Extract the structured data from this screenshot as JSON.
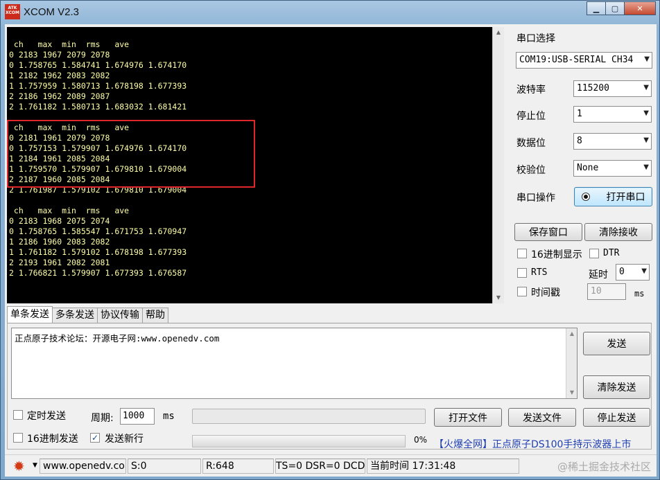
{
  "window": {
    "title": "XCOM V2.3",
    "logo_text": "ATK XCOM"
  },
  "terminal": {
    "lines": [
      " ch   max  min  rms   ave",
      "0 2183 1967 2079 2078",
      "0 1.758765 1.584741 1.674976 1.674170",
      "1 2182 1962 2083 2082",
      "1 1.757959 1.580713 1.678198 1.677393",
      "2 2186 1962 2089 2087",
      "2 1.761182 1.580713 1.683032 1.681421",
      "",
      " ch   max  min  rms   ave",
      "0 2181 1961 2079 2078",
      "0 1.757153 1.579907 1.674976 1.674170",
      "1 2184 1961 2085 2084",
      "1 1.759570 1.579907 1.679810 1.679004",
      "2 2187 1960 2085 2084",
      "2 1.761987 1.579102 1.679810 1.679004",
      "",
      " ch   max  min  rms   ave",
      "0 2183 1968 2075 2074",
      "0 1.758765 1.585547 1.671753 1.670947",
      "1 2186 1960 2083 2082",
      "1 1.761182 1.579102 1.678198 1.677393",
      "2 2193 1961 2082 2081",
      "2 1.766821 1.579907 1.677393 1.676587"
    ],
    "highlight_color": "#e0262a"
  },
  "settings": {
    "port_label": "串口选择",
    "port_value": "COM19:USB-SERIAL CH34",
    "baud_label": "波特率",
    "baud_value": "115200",
    "stop_label": "停止位",
    "stop_value": "1",
    "data_label": "数据位",
    "data_value": "8",
    "parity_label": "校验位",
    "parity_value": "None",
    "op_label": "串口操作",
    "op_button": "打开串口",
    "save_button": "保存窗口",
    "clear_recv_button": "清除接收",
    "hex_display": "16进制显示",
    "dtr": "DTR",
    "rts": "RTS",
    "delay_label": "延时",
    "delay_value": "0",
    "timestamp": "时间戳",
    "timestamp_value": "10",
    "ms": "ms"
  },
  "tabs": [
    "单条发送",
    "多条发送",
    "协议传输",
    "帮助"
  ],
  "send": {
    "text": "正点原子技术论坛：开源电子网:www.openedv.com",
    "send_button": "发送",
    "clear_send_button": "清除发送",
    "timed_send": "定时发送",
    "period_label": "周期:",
    "period_value": "1000",
    "period_unit": "ms",
    "open_file": "打开文件",
    "send_file": "发送文件",
    "stop_send": "停止发送",
    "hex_send": "16进制发送",
    "send_newline": "发送新行",
    "progress_text": "0%",
    "progress": 0,
    "ad_text": "【火爆全网】正点原子DS100手持示波器上市"
  },
  "status": {
    "url": "www.openedv.com",
    "s": "S:0",
    "r": "R:648",
    "lines": "TS=0 DSR=0 DCD=",
    "time": "当前时间 17:31:48",
    "watermark": "@稀土掘金技术社区"
  },
  "colors": {
    "accent": "#cc2a1a",
    "terminal_text": "#ffffa8",
    "ad": "#1f3fb0"
  }
}
